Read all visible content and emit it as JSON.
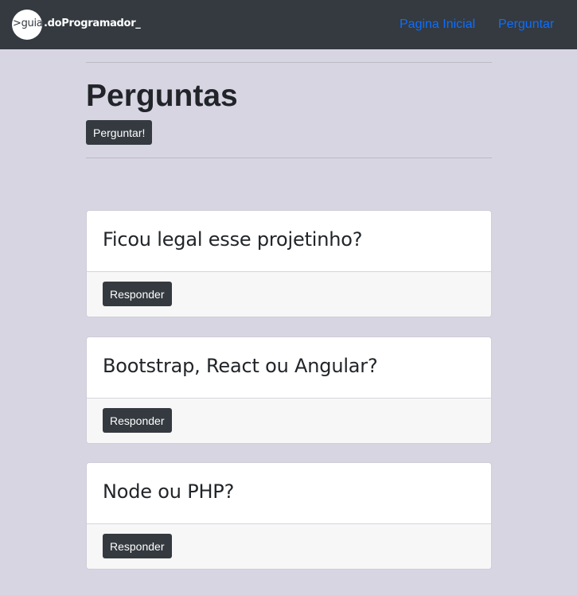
{
  "navbar": {
    "logo_circle_text": ">guia",
    "logo_rest_text": ".doProgramador_",
    "links": [
      {
        "label": "Pagina Inicial"
      },
      {
        "label": "Perguntar"
      }
    ],
    "colors": {
      "background": "#343a40",
      "link": "#0d6efd"
    }
  },
  "main": {
    "title": "Perguntas",
    "ask_button_label": "Perguntar!",
    "questions": [
      {
        "title": "Ficou legal esse projetinho?",
        "button_label": "Responder"
      },
      {
        "title": "Bootstrap, React ou Angular?",
        "button_label": "Responder"
      },
      {
        "title": "Node ou PHP?",
        "button_label": "Responder"
      }
    ]
  }
}
